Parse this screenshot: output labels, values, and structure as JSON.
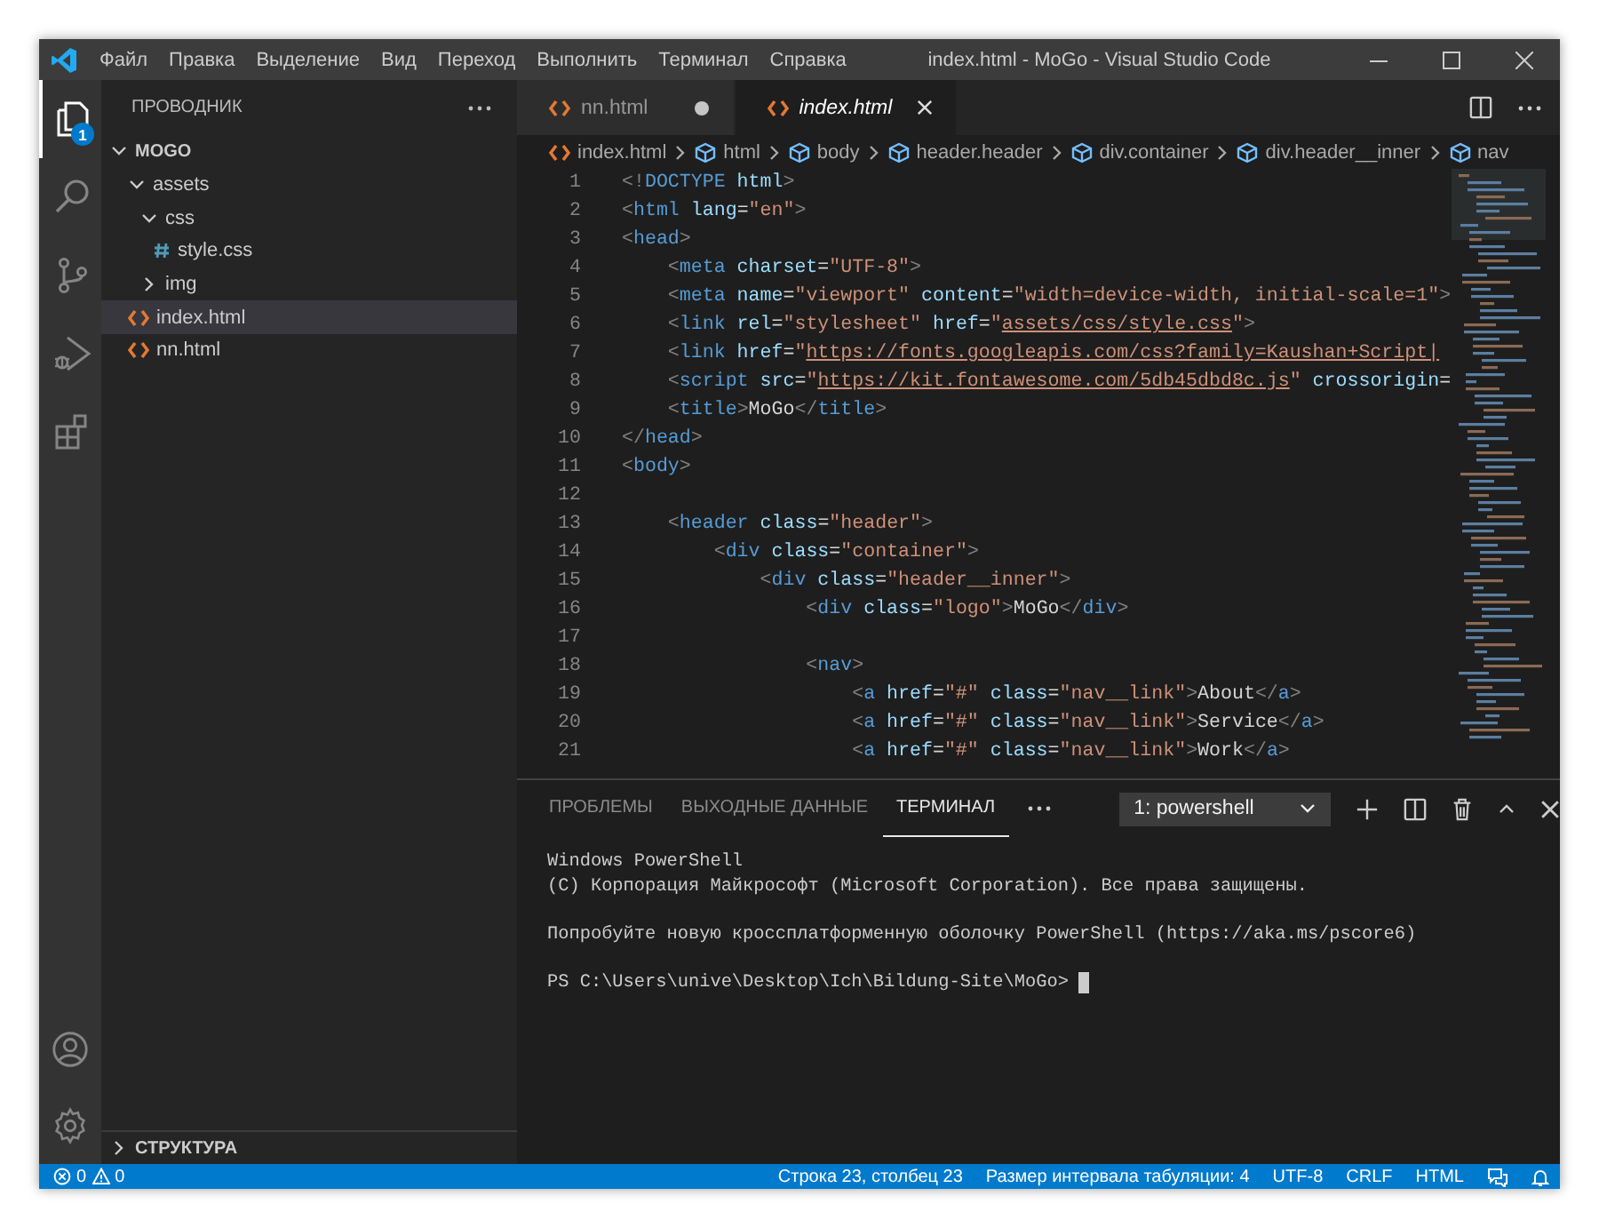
{
  "window": {
    "title": "index.html - MoGo - Visual Studio Code"
  },
  "menu": [
    "Файл",
    "Правка",
    "Выделение",
    "Вид",
    "Переход",
    "Выполнить",
    "Терминал",
    "Справка"
  ],
  "activity_bar": [
    {
      "kind": "explorer",
      "selected": true,
      "badge": "1"
    },
    {
      "kind": "search",
      "selected": false
    },
    {
      "kind": "source-control",
      "selected": false
    },
    {
      "kind": "run",
      "selected": false
    },
    {
      "kind": "extensions",
      "selected": false
    }
  ],
  "activity_bottom": [
    {
      "kind": "account"
    },
    {
      "kind": "settings"
    }
  ],
  "sidebar": {
    "title": "ПРОВОДНИК",
    "tree": [
      {
        "label": "MOGO",
        "kind": "root",
        "expanded": true,
        "selected": false,
        "children": [
          {
            "label": "assets",
            "kind": "folder",
            "expanded": true,
            "selected": false,
            "children": [
              {
                "label": "css",
                "kind": "folder",
                "expanded": true,
                "selected": false,
                "children": [
                  {
                    "label": "style.css",
                    "kind": "css",
                    "selected": false
                  }
                ]
              },
              {
                "label": "img",
                "kind": "folder",
                "expanded": false,
                "selected": false
              }
            ]
          },
          {
            "label": "index.html",
            "kind": "html",
            "selected": true
          },
          {
            "label": "nn.html",
            "kind": "html",
            "selected": false
          }
        ]
      }
    ],
    "outline": {
      "label": "СТРУКТУРА",
      "expanded": false
    }
  },
  "tabs": [
    {
      "label": "nn.html",
      "selected": false,
      "modified": true,
      "italic": false
    },
    {
      "label": "index.html",
      "selected": true,
      "modified": false,
      "italic": true
    }
  ],
  "breadcrumb": [
    {
      "label": "index.html",
      "kind": "file"
    },
    {
      "label": "html",
      "kind": "element"
    },
    {
      "label": "body",
      "kind": "element"
    },
    {
      "label": "header.header",
      "kind": "element"
    },
    {
      "label": "div.container",
      "kind": "element"
    },
    {
      "label": "div.header__inner",
      "kind": "element"
    },
    {
      "label": "nav",
      "kind": "element"
    }
  ],
  "code": [
    {
      "number": "1",
      "tokens": [
        {
          "kind": "punct",
          "text": "<!"
        },
        {
          "kind": "tag",
          "text": "DOCTYPE"
        },
        {
          "kind": "attr",
          "text": " html"
        },
        {
          "kind": "punct",
          "text": ">"
        }
      ]
    },
    {
      "number": "2",
      "tokens": [
        {
          "kind": "punct",
          "text": "<"
        },
        {
          "kind": "tag",
          "text": "html"
        },
        {
          "kind": "attr",
          "text": " lang"
        },
        {
          "kind": "plain",
          "text": "="
        },
        {
          "kind": "string",
          "text": "\"en\""
        },
        {
          "kind": "punct",
          "text": ">"
        }
      ]
    },
    {
      "number": "3",
      "tokens": [
        {
          "kind": "punct",
          "text": "<"
        },
        {
          "kind": "tag",
          "text": "head"
        },
        {
          "kind": "punct",
          "text": ">"
        }
      ]
    },
    {
      "number": "4",
      "tokens": [
        {
          "kind": "punct",
          "text": "    <"
        },
        {
          "kind": "tag",
          "text": "meta"
        },
        {
          "kind": "attr",
          "text": " charset"
        },
        {
          "kind": "plain",
          "text": "="
        },
        {
          "kind": "string",
          "text": "\"UTF-8\""
        },
        {
          "kind": "punct",
          "text": ">"
        }
      ]
    },
    {
      "number": "5",
      "tokens": [
        {
          "kind": "punct",
          "text": "    <"
        },
        {
          "kind": "tag",
          "text": "meta"
        },
        {
          "kind": "attr",
          "text": " name"
        },
        {
          "kind": "plain",
          "text": "="
        },
        {
          "kind": "string",
          "text": "\"viewport\""
        },
        {
          "kind": "attr",
          "text": " content"
        },
        {
          "kind": "plain",
          "text": "="
        },
        {
          "kind": "string",
          "text": "\"width=device-width, initial-scale=1\""
        },
        {
          "kind": "punct",
          "text": ">"
        }
      ]
    },
    {
      "number": "6",
      "tokens": [
        {
          "kind": "punct",
          "text": "    <"
        },
        {
          "kind": "tag",
          "text": "link"
        },
        {
          "kind": "attr",
          "text": " rel"
        },
        {
          "kind": "plain",
          "text": "="
        },
        {
          "kind": "string",
          "text": "\"stylesheet\""
        },
        {
          "kind": "attr",
          "text": " href"
        },
        {
          "kind": "plain",
          "text": "="
        },
        {
          "kind": "string",
          "text": "\""
        },
        {
          "kind": "link",
          "text": "assets/css/style.css"
        },
        {
          "kind": "string",
          "text": "\""
        },
        {
          "kind": "punct",
          "text": ">"
        }
      ]
    },
    {
      "number": "7",
      "tokens": [
        {
          "kind": "punct",
          "text": "    <"
        },
        {
          "kind": "tag",
          "text": "link"
        },
        {
          "kind": "attr",
          "text": " href"
        },
        {
          "kind": "plain",
          "text": "="
        },
        {
          "kind": "string",
          "text": "\""
        },
        {
          "kind": "link",
          "text": "https://fonts.googleapis.com/css?family=Kaushan+Script|"
        }
      ]
    },
    {
      "number": "8",
      "tokens": [
        {
          "kind": "punct",
          "text": "    <"
        },
        {
          "kind": "tag",
          "text": "script"
        },
        {
          "kind": "attr",
          "text": " src"
        },
        {
          "kind": "plain",
          "text": "="
        },
        {
          "kind": "string",
          "text": "\""
        },
        {
          "kind": "link",
          "text": "https://kit.fontawesome.com/5db45dbd8c.js"
        },
        {
          "kind": "string",
          "text": "\""
        },
        {
          "kind": "attr",
          "text": " crossorigin"
        },
        {
          "kind": "plain",
          "text": "="
        }
      ]
    },
    {
      "number": "9",
      "tokens": [
        {
          "kind": "punct",
          "text": "    <"
        },
        {
          "kind": "tag",
          "text": "title"
        },
        {
          "kind": "punct",
          "text": ">"
        },
        {
          "kind": "plain",
          "text": "MoGo"
        },
        {
          "kind": "punct",
          "text": "</"
        },
        {
          "kind": "tag",
          "text": "title"
        },
        {
          "kind": "punct",
          "text": ">"
        }
      ]
    },
    {
      "number": "10",
      "tokens": [
        {
          "kind": "punct",
          "text": "</"
        },
        {
          "kind": "tag",
          "text": "head"
        },
        {
          "kind": "punct",
          "text": ">"
        }
      ]
    },
    {
      "number": "11",
      "tokens": [
        {
          "kind": "punct",
          "text": "<"
        },
        {
          "kind": "tag",
          "text": "body"
        },
        {
          "kind": "punct",
          "text": ">"
        }
      ]
    },
    {
      "number": "12"
    },
    {
      "number": "13",
      "tokens": [
        {
          "kind": "punct",
          "text": "    <"
        },
        {
          "kind": "tag",
          "text": "header"
        },
        {
          "kind": "attr",
          "text": " class"
        },
        {
          "kind": "plain",
          "text": "="
        },
        {
          "kind": "string",
          "text": "\"header\""
        },
        {
          "kind": "punct",
          "text": ">"
        }
      ]
    },
    {
      "number": "14",
      "tokens": [
        {
          "kind": "punct",
          "text": "        <"
        },
        {
          "kind": "tag",
          "text": "div"
        },
        {
          "kind": "attr",
          "text": " class"
        },
        {
          "kind": "plain",
          "text": "="
        },
        {
          "kind": "string",
          "text": "\"container\""
        },
        {
          "kind": "punct",
          "text": ">"
        }
      ]
    },
    {
      "number": "15",
      "tokens": [
        {
          "kind": "punct",
          "text": "            <"
        },
        {
          "kind": "tag",
          "text": "div"
        },
        {
          "kind": "attr",
          "text": " class"
        },
        {
          "kind": "plain",
          "text": "="
        },
        {
          "kind": "string",
          "text": "\"header__inner\""
        },
        {
          "kind": "punct",
          "text": ">"
        }
      ]
    },
    {
      "number": "16",
      "tokens": [
        {
          "kind": "punct",
          "text": "                <"
        },
        {
          "kind": "tag",
          "text": "div"
        },
        {
          "kind": "attr",
          "text": " class"
        },
        {
          "kind": "plain",
          "text": "="
        },
        {
          "kind": "string",
          "text": "\"logo\""
        },
        {
          "kind": "punct",
          "text": ">"
        },
        {
          "kind": "plain",
          "text": "MoGo"
        },
        {
          "kind": "punct",
          "text": "</"
        },
        {
          "kind": "tag",
          "text": "div"
        },
        {
          "kind": "punct",
          "text": ">"
        }
      ]
    },
    {
      "number": "17"
    },
    {
      "number": "18",
      "tokens": [
        {
          "kind": "punct",
          "text": "                <"
        },
        {
          "kind": "tag",
          "text": "nav"
        },
        {
          "kind": "punct",
          "text": ">"
        }
      ]
    },
    {
      "number": "19",
      "tokens": [
        {
          "kind": "punct",
          "text": "                    <"
        },
        {
          "kind": "tag",
          "text": "a"
        },
        {
          "kind": "attr",
          "text": " href"
        },
        {
          "kind": "plain",
          "text": "="
        },
        {
          "kind": "string",
          "text": "\"#\""
        },
        {
          "kind": "attr",
          "text": " class"
        },
        {
          "kind": "plain",
          "text": "="
        },
        {
          "kind": "string",
          "text": "\"nav__link\""
        },
        {
          "kind": "punct",
          "text": ">"
        },
        {
          "kind": "plain",
          "text": "About"
        },
        {
          "kind": "punct",
          "text": "</"
        },
        {
          "kind": "tag",
          "text": "a"
        },
        {
          "kind": "punct",
          "text": ">"
        }
      ]
    },
    {
      "number": "20",
      "tokens": [
        {
          "kind": "punct",
          "text": "                    <"
        },
        {
          "kind": "tag",
          "text": "a"
        },
        {
          "kind": "attr",
          "text": " href"
        },
        {
          "kind": "plain",
          "text": "="
        },
        {
          "kind": "string",
          "text": "\"#\""
        },
        {
          "kind": "attr",
          "text": " class"
        },
        {
          "kind": "plain",
          "text": "="
        },
        {
          "kind": "string",
          "text": "\"nav__link\""
        },
        {
          "kind": "punct",
          "text": ">"
        },
        {
          "kind": "plain",
          "text": "Service"
        },
        {
          "kind": "punct",
          "text": "</"
        },
        {
          "kind": "tag",
          "text": "a"
        },
        {
          "kind": "punct",
          "text": ">"
        }
      ]
    },
    {
      "number": "21",
      "tokens": [
        {
          "kind": "punct",
          "text": "                    <"
        },
        {
          "kind": "tag",
          "text": "a"
        },
        {
          "kind": "attr",
          "text": " href"
        },
        {
          "kind": "plain",
          "text": "="
        },
        {
          "kind": "string",
          "text": "\"#\""
        },
        {
          "kind": "attr",
          "text": " class"
        },
        {
          "kind": "plain",
          "text": "="
        },
        {
          "kind": "string",
          "text": "\"nav__link\""
        },
        {
          "kind": "punct",
          "text": ">"
        },
        {
          "kind": "plain",
          "text": "Work"
        },
        {
          "kind": "punct",
          "text": "</"
        },
        {
          "kind": "tag",
          "text": "a"
        },
        {
          "kind": "punct",
          "text": ">"
        }
      ]
    }
  ],
  "panel": {
    "tabs": [
      {
        "label": "ПРОБЛЕМЫ",
        "selected": false
      },
      {
        "label": "ВЫХОДНЫЕ ДАННЫЕ",
        "selected": false
      },
      {
        "label": "ТЕРМИНАЛ",
        "selected": true
      }
    ],
    "terminal_select": "1: powershell",
    "terminal_output": [
      [
        "Windows PowerShell",
        "(C) Корпорация Майкрософт (Microsoft Corporation). Все права защищены."
      ],
      [
        "Попробуйте новую кроссплатформенную оболочку PowerShell (https://aka.ms/pscore6)"
      ]
    ],
    "prompt": {
      "text": "PS C:\\Users\\unive\\Desktop\\Ich\\Bildung-Site\\MoGo>",
      "cursor": true
    }
  },
  "status_bar": {
    "errors": "0",
    "warnings": "0",
    "items": [
      "Строка 23, столбец 23",
      "Размер интервала табуляции: 4",
      "UTF-8",
      "CRLF",
      "HTML"
    ]
  }
}
